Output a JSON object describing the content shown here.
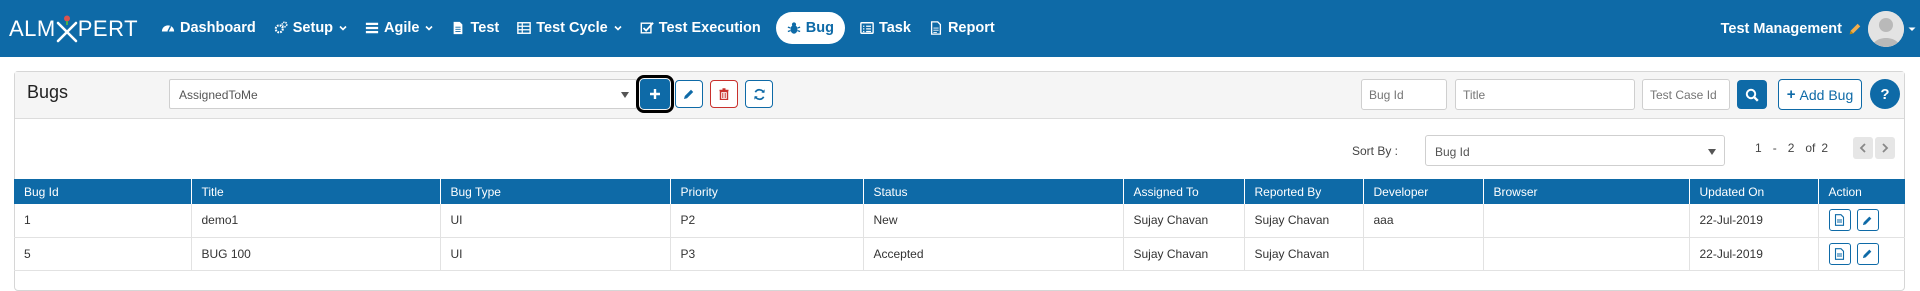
{
  "brand": {
    "logo_left": "ALM",
    "logo_right": "PERT"
  },
  "nav": {
    "items": [
      {
        "label": "Dashboard",
        "icon": "dashboard-icon",
        "dropdown": false,
        "active": false
      },
      {
        "label": "Setup",
        "icon": "gears-icon",
        "dropdown": true,
        "active": false
      },
      {
        "label": "Agile",
        "icon": "list-icon",
        "dropdown": true,
        "active": false
      },
      {
        "label": "Test",
        "icon": "document-icon",
        "dropdown": false,
        "active": false
      },
      {
        "label": "Test Cycle",
        "icon": "table-icon",
        "dropdown": true,
        "active": false
      },
      {
        "label": "Test Execution",
        "icon": "checkbox-icon",
        "dropdown": false,
        "active": false
      },
      {
        "label": "Bug",
        "icon": "bug-icon",
        "dropdown": false,
        "active": true
      },
      {
        "label": "Task",
        "icon": "tasks-icon",
        "dropdown": false,
        "active": false
      },
      {
        "label": "Report",
        "icon": "report-icon",
        "dropdown": false,
        "active": false
      }
    ],
    "user_label": "Test Management"
  },
  "page": {
    "title": "Bugs",
    "filter_value": "AssignedToMe",
    "search": {
      "bug_id_placeholder": "Bug Id",
      "title_placeholder": "Title",
      "test_case_id_placeholder": "Test Case Id"
    },
    "add_bug_label": "Add Bug",
    "help_label": "?"
  },
  "sort": {
    "label": "Sort By :",
    "value": "Bug Id"
  },
  "pager": {
    "from": "1",
    "dash": "-",
    "to": "2",
    "of": "of",
    "total": "2"
  },
  "table": {
    "columns": [
      "Bug Id",
      "Title",
      "Bug Type",
      "Priority",
      "Status",
      "Assigned To",
      "Reported By",
      "Developer",
      "Browser",
      "Updated On",
      "Action"
    ],
    "rows": [
      {
        "bug_id": "1",
        "title": "demo1",
        "bug_type": "UI",
        "priority": "P2",
        "status": "New",
        "assigned_to": "Sujay Chavan",
        "reported_by": "Sujay Chavan",
        "developer": "aaa",
        "browser": "",
        "updated_on": "22-Jul-2019"
      },
      {
        "bug_id": "5",
        "title": "BUG 100",
        "bug_type": "UI",
        "priority": "P3",
        "status": "Accepted",
        "assigned_to": "Sujay Chavan",
        "reported_by": "Sujay Chavan",
        "developer": "",
        "browser": "",
        "updated_on": "22-Jul-2019"
      }
    ]
  },
  "colors": {
    "primary": "#0e6aa7",
    "danger": "#c9302c",
    "header_bg": "#f5f5f5",
    "logo_accent": "#d9534f",
    "pencil": "#f0ad4e"
  }
}
